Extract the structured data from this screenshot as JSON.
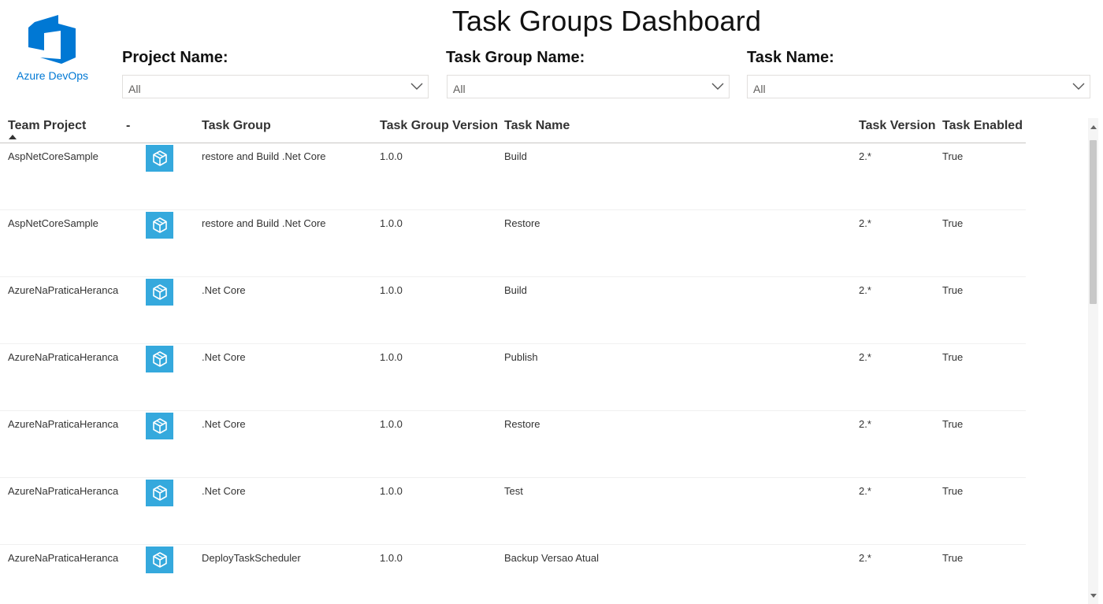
{
  "app": {
    "logo_text": "Azure DevOps",
    "title": "Task Groups Dashboard",
    "accent_color": "#0078d4"
  },
  "filters": {
    "project": {
      "label": "Project Name:",
      "value": "All"
    },
    "task_group": {
      "label": "Task Group Name:",
      "value": "All"
    },
    "task": {
      "label": "Task Name:",
      "value": "All"
    }
  },
  "table": {
    "columns": [
      "Team Project",
      "-",
      "Task Group",
      "Task Group Version",
      "Task Name",
      "Task Version",
      "Task Enabled"
    ],
    "sort": {
      "column": "Team Project",
      "direction": "ascending"
    },
    "icon_name": "task-group-cube-icon",
    "rows": [
      [
        "AspNetCoreSample",
        "",
        "restore and Build .Net Core",
        "1.0.0",
        "Build",
        "2.*",
        "True"
      ],
      [
        "AspNetCoreSample",
        "",
        "restore and Build .Net Core",
        "1.0.0",
        "Restore",
        "2.*",
        "True"
      ],
      [
        "AzureNaPraticaHeranca",
        "",
        ".Net Core",
        "1.0.0",
        "Build",
        "2.*",
        "True"
      ],
      [
        "AzureNaPraticaHeranca",
        "",
        ".Net Core",
        "1.0.0",
        "Publish",
        "2.*",
        "True"
      ],
      [
        "AzureNaPraticaHeranca",
        "",
        ".Net Core",
        "1.0.0",
        "Restore",
        "2.*",
        "True"
      ],
      [
        "AzureNaPraticaHeranca",
        "",
        ".Net Core",
        "1.0.0",
        "Test",
        "2.*",
        "True"
      ],
      [
        "AzureNaPraticaHeranca",
        "",
        "DeployTaskScheduler",
        "1.0.0",
        "Backup Versao Atual",
        "2.*",
        "True"
      ]
    ]
  }
}
